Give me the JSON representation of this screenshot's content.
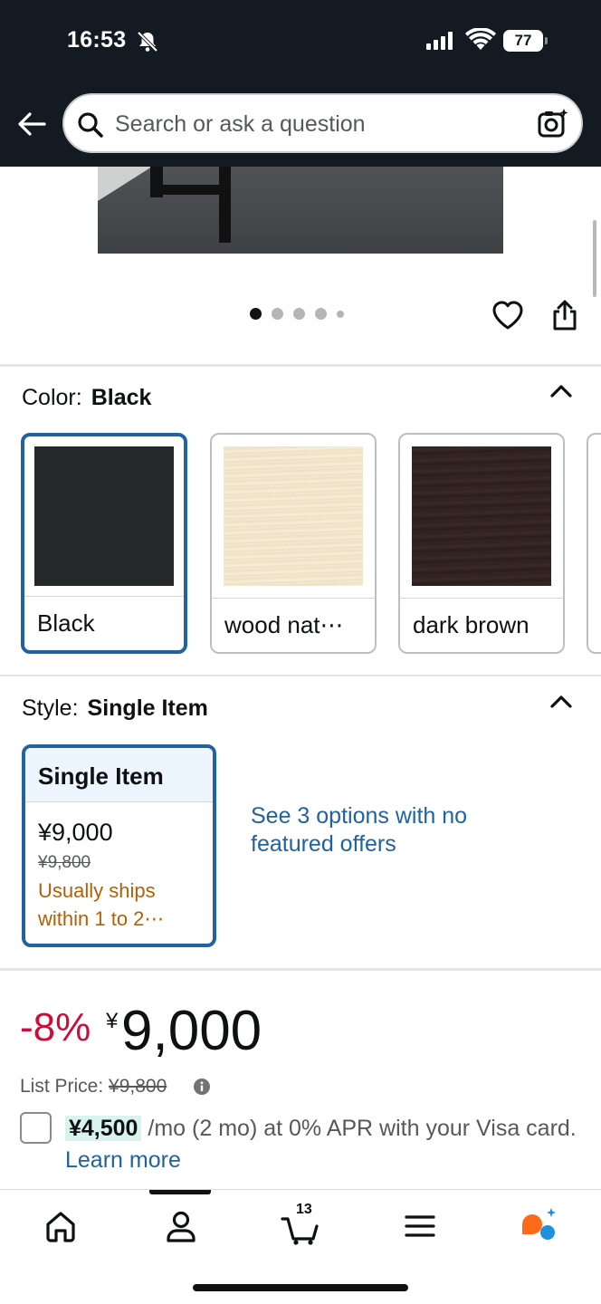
{
  "status_bar": {
    "time": "16:53",
    "battery": "77"
  },
  "search": {
    "placeholder": "Search or ask a question"
  },
  "gallery": {
    "image_count": 5,
    "active_index": 0
  },
  "color": {
    "label": "Color:",
    "selected": "Black",
    "options": [
      {
        "label": "Black",
        "swatch": "#26292a",
        "selected": true
      },
      {
        "label": "wood nat⋯",
        "swatch": "#f3e6cd",
        "selected": false
      },
      {
        "label": "dark brown",
        "swatch": "#2e2120",
        "selected": false
      }
    ]
  },
  "style": {
    "label": "Style:",
    "selected": "Single Item",
    "card": {
      "title": "Single Item",
      "price": "¥9,000",
      "list_price": "¥9,800",
      "shipping": "Usually ships within 1 to 2⋯"
    },
    "see_options": "See 3 options with no featured offers"
  },
  "price": {
    "discount": "-8%",
    "currency": "¥",
    "amount": "9,000",
    "list_label": "List Price:",
    "list_value": "¥9,800"
  },
  "installment": {
    "amount": "¥4,500",
    "text": " /mo (2 mo) at 0% APR with your Visa card. ",
    "learn_more": "Learn more"
  },
  "bottom_nav": {
    "items": [
      "home-icon",
      "account-icon",
      "cart-icon",
      "menu-icon",
      "rufus-assistant-icon"
    ],
    "cart_count": "13",
    "active": "account-icon"
  },
  "colors": {
    "header_bg": "#131a22",
    "link": "#2162a1",
    "selected_border": "#2162a1",
    "discount": "#cc0c39",
    "shipping": "#b45f06"
  }
}
